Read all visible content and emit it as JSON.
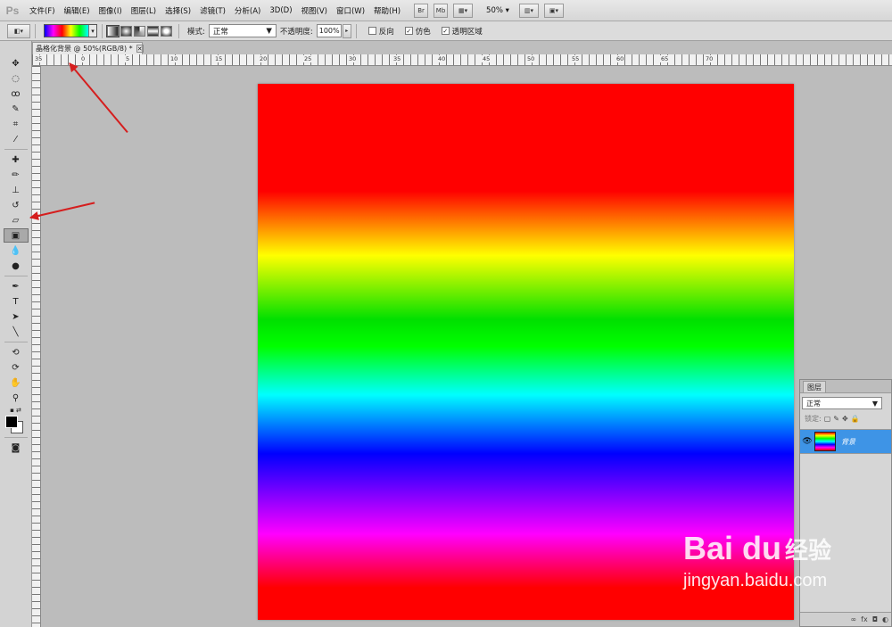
{
  "app": {
    "logo": "Ps"
  },
  "menus": [
    "文件(F)",
    "编辑(E)",
    "图像(I)",
    "图层(L)",
    "选择(S)",
    "滤镜(T)",
    "分析(A)",
    "3D(D)",
    "视图(V)",
    "窗口(W)",
    "帮助(H)"
  ],
  "menubar_buttons": {
    "bridge": "Br",
    "minibridge": "Mb",
    "zoom": "50%"
  },
  "options": {
    "mode_label": "模式:",
    "mode_value": "正常",
    "opacity_label": "不透明度:",
    "opacity_value": "100%",
    "reverse_label": "反向",
    "dither_label": "仿色",
    "transparency_label": "透明区域",
    "reverse_checked": false,
    "dither_checked": true,
    "transparency_checked": true
  },
  "document": {
    "tab_title": "晶格化背景 @ 50%(RGB/8) *"
  },
  "ruler": {
    "top_ticks": [
      "35",
      "0",
      "5",
      "10",
      "15",
      "20",
      "25",
      "30",
      "35",
      "40",
      "45",
      "50",
      "55",
      "60",
      "65",
      "70"
    ]
  },
  "gradient": {
    "colors": [
      "#ff0000",
      "#ffff00",
      "#00ff00",
      "#00ffff",
      "#0000ff",
      "#ff00ff",
      "#ff0000"
    ]
  },
  "layers": {
    "tab": "图层",
    "blend_mode": "正常",
    "lock_label": "锁定:",
    "items": [
      {
        "name": "背景",
        "visible": true,
        "selected": true
      }
    ]
  },
  "watermark": {
    "brand": "Bai du",
    "extra": "经验",
    "url": "jingyan.baidu.com"
  }
}
